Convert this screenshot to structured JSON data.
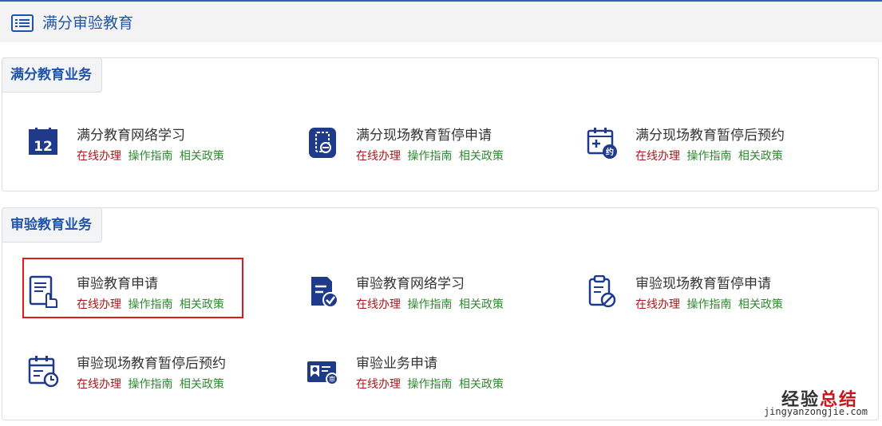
{
  "header": {
    "title": "满分审验教育",
    "icon": "list-icon"
  },
  "sections": [
    {
      "title": "满分教育业务",
      "items": [
        {
          "name": "满分教育网络学习",
          "icon": "calendar-12-icon"
        },
        {
          "name": "满分现场教育暂停申请",
          "icon": "clipboard-pause-icon"
        },
        {
          "name": "满分现场教育暂停后预约",
          "icon": "calendar-appointment-icon"
        }
      ]
    },
    {
      "title": "审验教育业务",
      "items": [
        {
          "name": "审验教育申请",
          "icon": "document-hand-icon"
        },
        {
          "name": "审验教育网络学习",
          "icon": "document-check-icon"
        },
        {
          "name": "审验现场教育暂停申请",
          "icon": "clipboard-ban-icon"
        },
        {
          "name": "审验现场教育暂停后预约",
          "icon": "calendar-clock-icon"
        },
        {
          "name": "审验业务申请",
          "icon": "id-card-icon"
        }
      ]
    }
  ],
  "links": {
    "online": "在线办理",
    "guide": "操作指南",
    "policy": "相关政策"
  },
  "watermark": {
    "main_left": "经验",
    "main_right": "总结",
    "sub": "jingyanzongjie.com"
  },
  "colors": {
    "accent": "#2154a8",
    "icon_navy": "#1f3a8a",
    "link_red": "#a8161b",
    "link_green": "#2f8a2f",
    "highlight": "#e01919"
  }
}
